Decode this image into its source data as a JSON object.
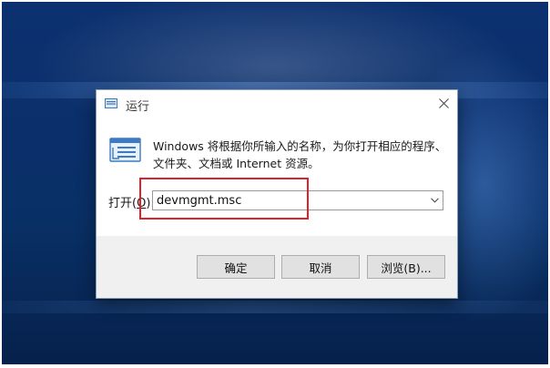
{
  "dialog": {
    "title": "运行",
    "description_line1": "Windows 将根据你所输入的名称，为你打开相应的程序、",
    "description_line2": "文件夹、文档或 Internet 资源。",
    "open_label_prefix": "打开(",
    "open_label_key": "O",
    "open_label_suffix": "):",
    "command_value": "devmgmt.msc"
  },
  "buttons": {
    "ok": "确定",
    "cancel": "取消",
    "browse": "浏览(B)..."
  },
  "colors": {
    "highlight": "#e0202a",
    "desktop": "#0a2f6a"
  },
  "icons": {
    "title": "run-icon",
    "close": "close-icon",
    "dropdown": "chevron-down-icon",
    "large": "run-icon"
  }
}
